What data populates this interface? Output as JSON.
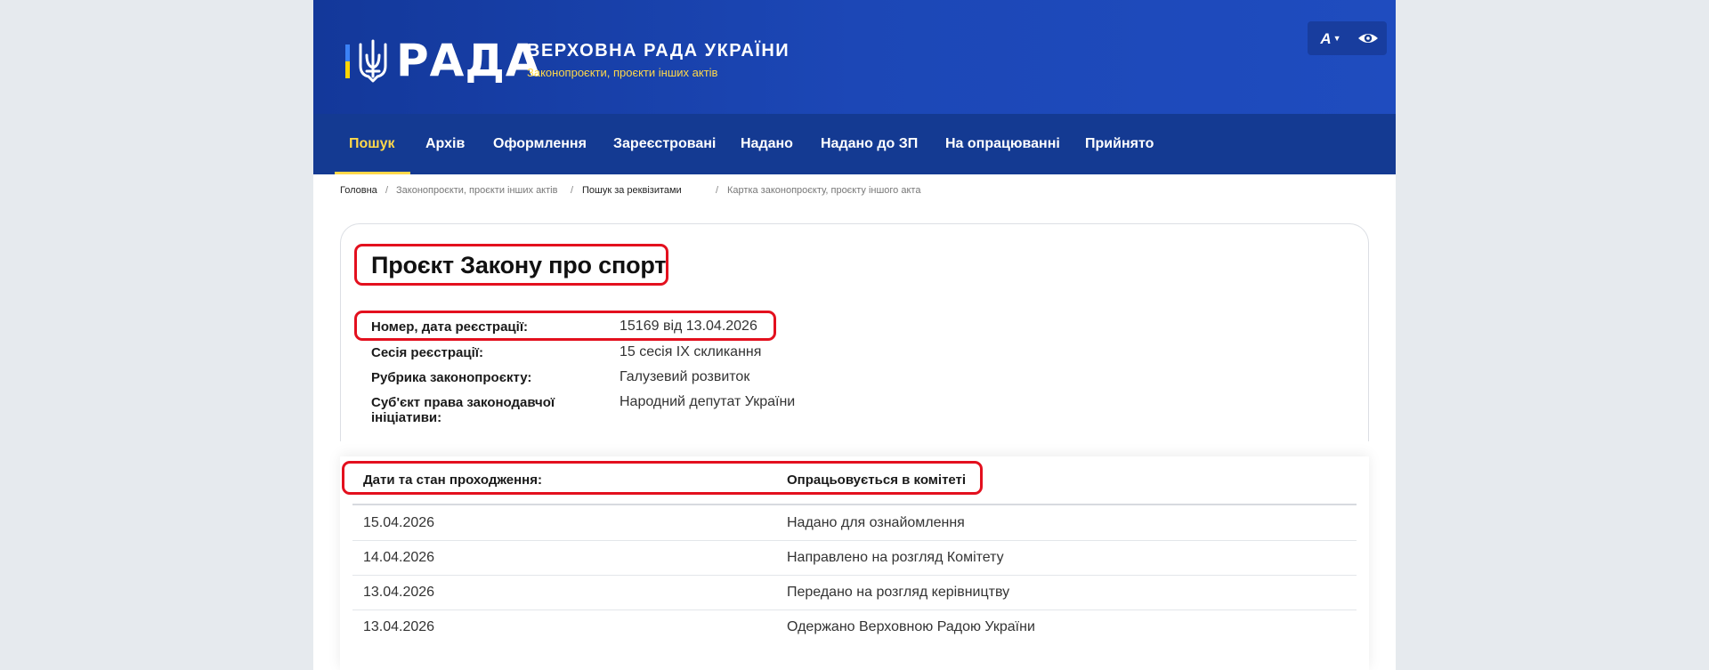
{
  "header": {
    "logo_word": "РАДА",
    "site_title": "ВЕРХОВНА РАДА УКРАЇНИ",
    "site_subtitle": "Законопроєкти, проєкти інших актів",
    "font_size_label": "A",
    "colors": {
      "header_blue": "#1c47b6",
      "nav_blue": "#143a92",
      "accent_yellow": "#ffd84a",
      "highlight_red": "#e3101e"
    },
    "icons": [
      "trident-icon",
      "chevron-down-icon",
      "eye-icon"
    ]
  },
  "nav": {
    "items": [
      {
        "label": "Пошук",
        "active": true
      },
      {
        "label": "Архів"
      },
      {
        "label": "Оформлення"
      },
      {
        "label": "Зареєстровані"
      },
      {
        "label": "Надано"
      },
      {
        "label": "Надано до ЗП"
      },
      {
        "label": "На опрацюванні"
      },
      {
        "label": "Прийнято"
      }
    ]
  },
  "breadcrumb": {
    "items": [
      "Головна",
      "Законопроєкти, проєкти інших актів",
      "Пошук за реквізитами",
      "Картка законопроєкту, проєкту іншого акта"
    ]
  },
  "bill": {
    "title": "Проєкт Закону про спорт",
    "fields": [
      {
        "label": "Номер, дата реєстрації:",
        "value": "15169 від 13.04.2026"
      },
      {
        "label": "Сесія реєстрації:",
        "value": "15 сесія IX скликання"
      },
      {
        "label": "Рубрика законопроєкту:",
        "value": "Галузевий розвиток"
      },
      {
        "label": "Суб'єкт права законодавчої ініціативи:",
        "value": "Народний депутат України"
      }
    ]
  },
  "status": {
    "header_label": "Дати та стан проходження:",
    "header_value": "Опрацьовується в комітеті",
    "rows": [
      {
        "date": "15.04.2026",
        "event": "Надано для ознайомлення"
      },
      {
        "date": "14.04.2026",
        "event": "Направлено на розгляд Комітету"
      },
      {
        "date": "13.04.2026",
        "event": "Передано на розгляд керівництву"
      },
      {
        "date": "13.04.2026",
        "event": "Одержано Верховною Радою України"
      }
    ]
  }
}
